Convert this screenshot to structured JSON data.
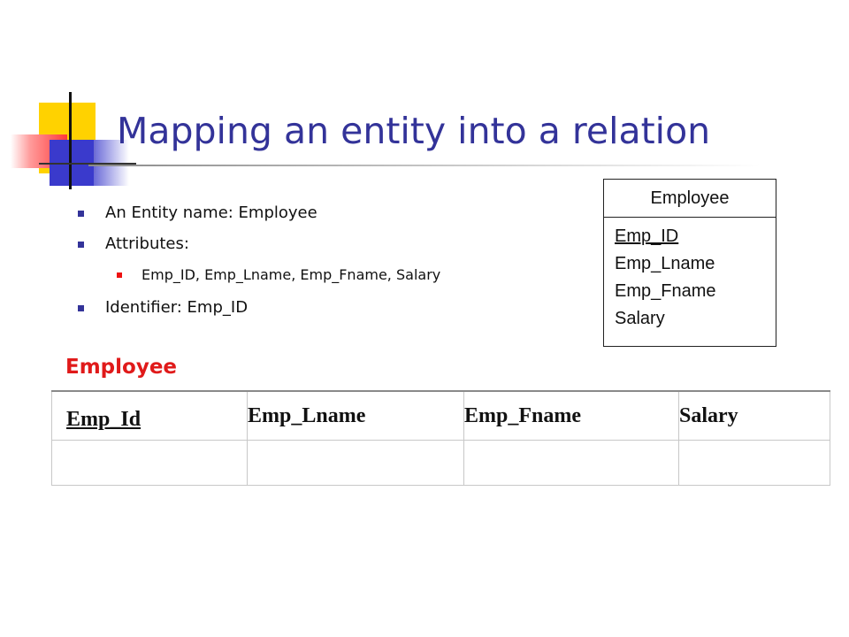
{
  "slide": {
    "title": "Mapping an entity into a relation",
    "bullets": [
      {
        "text": "An Entity name: Employee",
        "level": 1
      },
      {
        "text": "Attributes:",
        "level": 1
      },
      {
        "text": "Emp_ID, Emp_Lname, Emp_Fname, Salary",
        "level": 2
      },
      {
        "text": "Identifier: Emp_ID",
        "level": 1
      }
    ],
    "entity_box": {
      "name": "Employee",
      "attributes": [
        "Emp_ID",
        "Emp_Lname",
        "Emp_Fname",
        "Salary"
      ],
      "identifier": "Emp_ID"
    },
    "relation": {
      "label": "Employee",
      "columns": [
        "Emp_Id",
        "Emp_Lname",
        "Emp_Fname",
        "Salary"
      ],
      "primary_key": "Emp_Id",
      "rows": [
        [
          "",
          "",
          "",
          ""
        ]
      ]
    }
  },
  "colors": {
    "title": "#333399",
    "bullet_level1": "#333399",
    "bullet_level2": "#ee1111",
    "relation_label": "#e01a1a"
  }
}
